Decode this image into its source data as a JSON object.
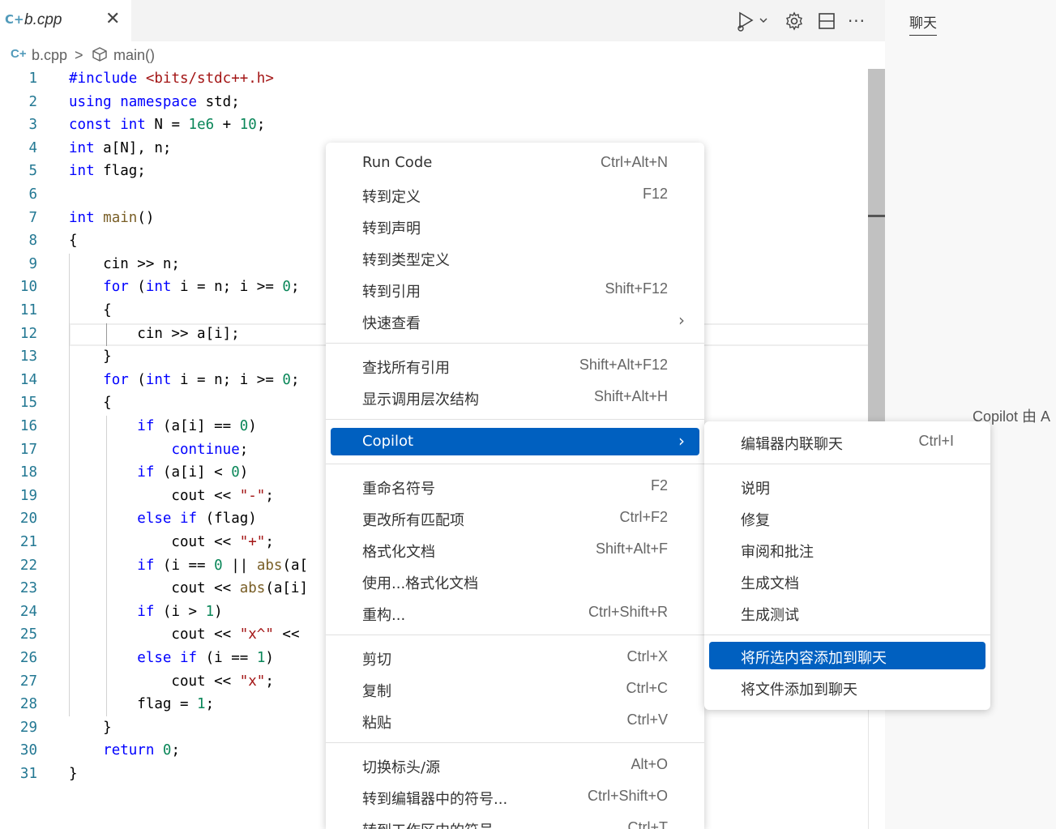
{
  "tab": {
    "label": "b.cpp",
    "close": "✕"
  },
  "toolbar": {
    "run": "run-debug",
    "settings": "gear",
    "layout": "split",
    "more": "···"
  },
  "breadcrumb": {
    "file": "b.cpp",
    "sep": ">",
    "symbol": "main()"
  },
  "chat": {
    "tab_label": "聊天",
    "copilot_text": "Copilot 由 A"
  },
  "gutter": [
    "1",
    "2",
    "3",
    "4",
    "5",
    "6",
    "7",
    "8",
    "9",
    "10",
    "11",
    "12",
    "13",
    "14",
    "15",
    "16",
    "17",
    "18",
    "19",
    "20",
    "21",
    "22",
    "23",
    "24",
    "25",
    "26",
    "27",
    "28",
    "29",
    "30",
    "31"
  ],
  "code": [
    "#include <bits/stdc++.h>",
    "using namespace std;",
    "const int N = 1e6 + 10;",
    "int a[N], n;",
    "int flag;",
    "",
    "int main()",
    "{",
    "    cin >> n;",
    "    for (int i = n; i >= 0;",
    "    {",
    "        cin >> a[i];",
    "    }",
    "    for (int i = n; i >= 0;",
    "    {",
    "        if (a[i] == 0)",
    "            continue;",
    "        if (a[i] < 0)",
    "            cout << \"-\";",
    "        else if (flag)",
    "            cout << \"+\";",
    "        if (i == 0 || abs(a[",
    "            cout << abs(a[i]",
    "        if (i > 1)",
    "            cout << \"x^\" <<",
    "        else if (i == 1)",
    "            cout << \"x\";",
    "        flag = 1;",
    "    }",
    "    return 0;",
    "}"
  ],
  "context_menu": {
    "items": [
      {
        "label": "Run Code",
        "key": "Ctrl+Alt+N"
      },
      {
        "label": "转到定义",
        "key": "F12"
      },
      {
        "label": "转到声明",
        "key": ""
      },
      {
        "label": "转到类型定义",
        "key": ""
      },
      {
        "label": "转到引用",
        "key": "Shift+F12"
      },
      {
        "label": "快速查看",
        "key": ""
      },
      {
        "label": "查找所有引用",
        "key": "Shift+Alt+F12"
      },
      {
        "label": "显示调用层次结构",
        "key": "Shift+Alt+H"
      },
      {
        "label": "Copilot",
        "key": ""
      },
      {
        "label": "重命名符号",
        "key": "F2"
      },
      {
        "label": "更改所有匹配项",
        "key": "Ctrl+F2"
      },
      {
        "label": "格式化文档",
        "key": "Shift+Alt+F"
      },
      {
        "label": "使用...格式化文档",
        "key": ""
      },
      {
        "label": "重构...",
        "key": "Ctrl+Shift+R"
      },
      {
        "label": "剪切",
        "key": "Ctrl+X"
      },
      {
        "label": "复制",
        "key": "Ctrl+C"
      },
      {
        "label": "粘贴",
        "key": "Ctrl+V"
      },
      {
        "label": "切换标头/源",
        "key": "Alt+O"
      },
      {
        "label": "转到编辑器中的符号...",
        "key": "Ctrl+Shift+O"
      },
      {
        "label": "转到工作区中的符号",
        "key": "Ctrl+T"
      }
    ]
  },
  "submenu": {
    "items": [
      {
        "label": "编辑器内联聊天",
        "key": "Ctrl+I"
      },
      {
        "label": "说明",
        "key": ""
      },
      {
        "label": "修复",
        "key": ""
      },
      {
        "label": "审阅和批注",
        "key": ""
      },
      {
        "label": "生成文档",
        "key": ""
      },
      {
        "label": "生成测试",
        "key": ""
      },
      {
        "label": "将所选内容添加到聊天",
        "key": ""
      },
      {
        "label": "将文件添加到聊天",
        "key": ""
      }
    ]
  },
  "colors": {
    "accent": "#0060c0",
    "line_number": "#237893",
    "keyword": "#0000ff"
  }
}
